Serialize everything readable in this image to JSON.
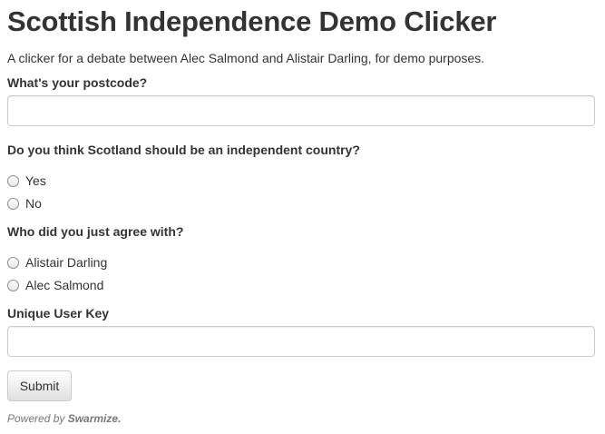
{
  "page": {
    "title": "Scottish Independence Demo Clicker",
    "description": "A clicker for a debate between Alec Salmond and Alistair Darling, for demo purposes."
  },
  "form": {
    "postcode": {
      "label": "What's your postcode?",
      "value": "",
      "placeholder": ""
    },
    "independence_question": {
      "label": "Do you think Scotland should be an independent country?",
      "options": [
        "Yes",
        "No"
      ]
    },
    "agree_question": {
      "label": "Who did you just agree with?",
      "options": [
        "Alistair Darling",
        "Alec Salmond"
      ]
    },
    "user_key": {
      "label": "Unique User Key",
      "value": "",
      "placeholder": ""
    },
    "submit_label": "Submit"
  },
  "footer": {
    "prefix": "Powered by ",
    "brand": "Swarmize."
  }
}
